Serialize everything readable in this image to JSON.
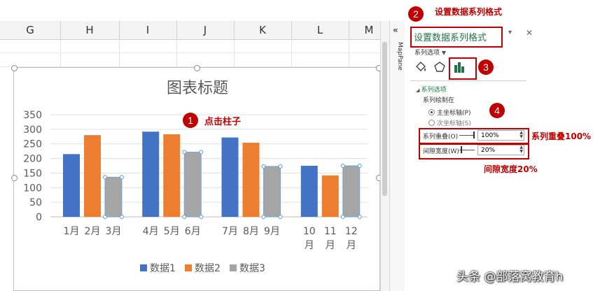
{
  "sheet": {
    "columns": [
      "G",
      "H",
      "I",
      "J",
      "K",
      "L",
      "M"
    ]
  },
  "chart": {
    "selection_note": "点击柱子"
  },
  "chart_data": {
    "type": "bar",
    "title": "图表标题",
    "categories": [
      "1月",
      "2月",
      "3月",
      "4月",
      "5月",
      "6月",
      "7月",
      "8月",
      "9月",
      "10月",
      "11月",
      "12月"
    ],
    "series": [
      {
        "name": "数据1",
        "values": [
          215,
          null,
          null,
          292,
          null,
          null,
          272,
          null,
          null,
          175,
          null,
          null
        ],
        "color": "#4472c4"
      },
      {
        "name": "数据2",
        "values": [
          null,
          280,
          null,
          null,
          283,
          null,
          null,
          254,
          null,
          null,
          142,
          null
        ],
        "color": "#ed7d31"
      },
      {
        "name": "数据3",
        "values": [
          null,
          null,
          136,
          null,
          null,
          222,
          null,
          null,
          173,
          null,
          null,
          175
        ],
        "color": "#a5a5a5"
      }
    ],
    "ylim": [
      0,
      350
    ],
    "yticks": [
      0,
      50,
      100,
      150,
      200,
      250,
      300,
      350
    ],
    "grid": true,
    "legend": "bottom"
  },
  "mappane": {
    "collapse": "«",
    "label": "MapPane"
  },
  "pane": {
    "heading_annotation": "设置数据系列格式",
    "title": "设置数据系列格式",
    "series_options_dropdown": "系列选项",
    "section_title": "系列选项",
    "plot_on_label": "系列绘制在",
    "primary_axis": "主坐标轴(P)",
    "secondary_axis": "次坐标轴(S)",
    "overlap_label": "系列重叠(O)",
    "overlap_value": "100%",
    "overlap_annotation": "系列重叠100%",
    "gap_label": "间隙宽度(W)",
    "gap_value": "20%",
    "gap_annotation": "间隙宽度20%",
    "steps": [
      "1",
      "2",
      "3",
      "4"
    ]
  },
  "watermark": "头条 @部落窝教育h",
  "colors": {
    "annotation": "#c00000",
    "accent": "#217346"
  }
}
